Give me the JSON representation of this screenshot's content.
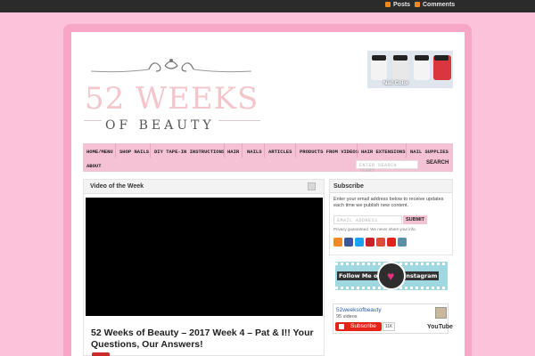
{
  "topbar": {
    "posts": "Posts",
    "comments": "Comments"
  },
  "logo": {
    "line1": "52 WEEKS",
    "line2": "OF BEAUTY"
  },
  "ad": {
    "label": "Nail Color"
  },
  "nav": {
    "items": [
      "HOME/MENU",
      "SHOP NAILS",
      "DIY TAPE-IN INSTRUCTIONS",
      "HAIR",
      "NAILS",
      "ARTICLES",
      "PRODUCTS FROM VIDEOS",
      "HAIR EXTENSIONS",
      "NAIL SUPPLIES",
      "ABOUT"
    ],
    "search_placeholder": "ENTER SEARCH TERMS",
    "search_button": "SEARCH"
  },
  "video": {
    "header": "Video of the Week",
    "title": "52 Weeks of Beauty – 2017 Week 4 – Pat & I!! Your Questions, Our Answers!"
  },
  "subscribe": {
    "header": "Subscribe",
    "desc": "Enter your email address below to receive updates each time we publish new content.",
    "email_placeholder": "EMAIL ADDRESS",
    "button": "SUBMIT",
    "privacy": "Privacy guaranteed. We never share your info."
  },
  "social_icons": [
    "rss-icon",
    "facebook-icon",
    "twitter-icon",
    "pinterest-icon",
    "google-plus-icon",
    "youtube-icon",
    "instagram-icon"
  ],
  "social_colors": [
    "#f08a24",
    "#3b5998",
    "#1da1f2",
    "#cb2027",
    "#dd4b39",
    "#e62117",
    "#5a8fa8"
  ],
  "instagram": {
    "text_left": "Follow Me on",
    "text_right": "Instagram"
  },
  "youtube": {
    "channel": "52weeksofbeauty",
    "videos": "95 videos",
    "subscribe": "Subscribe",
    "count": "11K",
    "logo": "YouTube"
  }
}
